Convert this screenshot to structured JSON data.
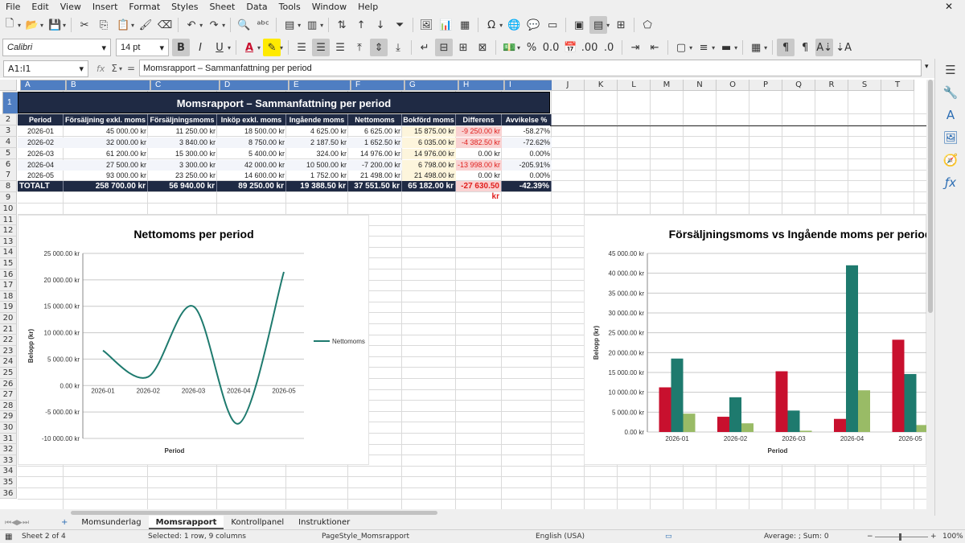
{
  "menu": [
    "File",
    "Edit",
    "View",
    "Insert",
    "Format",
    "Styles",
    "Sheet",
    "Data",
    "Tools",
    "Window",
    "Help"
  ],
  "toolbar": {
    "font_name": "Calibri",
    "font_size": "14 pt"
  },
  "formula": {
    "name_box": "A1:I1",
    "content": "Momsrapport – Sammanfattning per period",
    "fx_icon": "fx",
    "sum_icon": "Σ",
    "eq_icon": "="
  },
  "columns": [
    "A",
    "B",
    "C",
    "D",
    "E",
    "F",
    "G",
    "H",
    "I",
    "J",
    "K",
    "L",
    "M",
    "N",
    "O",
    "P",
    "Q",
    "R",
    "S",
    "T"
  ],
  "rows": [
    "1",
    "2",
    "3",
    "4",
    "5",
    "6",
    "7",
    "8",
    "9",
    "10",
    "11",
    "12",
    "13",
    "14",
    "15",
    "16",
    "17",
    "18",
    "19",
    "20",
    "21",
    "22",
    "23",
    "24",
    "25",
    "26",
    "27",
    "28",
    "29",
    "30",
    "31",
    "32",
    "33",
    "34",
    "35",
    "36"
  ],
  "sheet": {
    "title": "Momsrapport – Sammanfattning per period",
    "headers": [
      "Period",
      "Försäljning exkl. moms",
      "Försäljningsmoms",
      "Inköp exkl. moms",
      "Ingående moms",
      "Nettomoms",
      "Bokförd moms",
      "Differens",
      "Avvikelse %"
    ],
    "rows": [
      [
        "2026-01",
        "45 000.00 kr",
        "11 250.00 kr",
        "18 500.00 kr",
        "4 625.00 kr",
        "6 625.00 kr",
        "15 875.00 kr",
        "-9 250.00 kr",
        "-58.27%"
      ],
      [
        "2026-02",
        "32 000.00 kr",
        "3 840.00 kr",
        "8 750.00 kr",
        "2 187.50 kr",
        "1 652.50 kr",
        "6 035.00 kr",
        "-4 382.50 kr",
        "-72.62%"
      ],
      [
        "2026-03",
        "61 200.00 kr",
        "15 300.00 kr",
        "5 400.00 kr",
        "324.00 kr",
        "14 976.00 kr",
        "14 976.00 kr",
        "0.00 kr",
        "0.00%"
      ],
      [
        "2026-04",
        "27 500.00 kr",
        "3 300.00 kr",
        "42 000.00 kr",
        "10 500.00 kr",
        "-7 200.00 kr",
        "6 798.00 kr",
        "-13 998.00 kr",
        "-205.91%"
      ],
      [
        "2026-05",
        "93 000.00 kr",
        "23 250.00 kr",
        "14 600.00 kr",
        "1 752.00 kr",
        "21 498.00 kr",
        "21 498.00 kr",
        "0.00 kr",
        "0.00%"
      ]
    ],
    "total": [
      "TOTALT",
      "258 700.00 kr",
      "56 940.00 kr",
      "89 250.00 kr",
      "19 388.50 kr",
      "37 551.50 kr",
      "65 182.00 kr",
      "-27 630.50 kr",
      "-42.39%"
    ]
  },
  "colors": {
    "header_bg": "#1f2a44",
    "diff_neg_bg": "#f9d2d2",
    "diff_neg_text": "#e0201e",
    "booked_bg": "#fdf5dc",
    "teal": "#1e7a6e",
    "red": "#c8102e",
    "green": "#99bb66"
  },
  "chart_data": [
    {
      "type": "line",
      "title": "Nettomoms per period",
      "xlabel": "Period",
      "ylabel": "Belopp (kr)",
      "categories": [
        "2026-01",
        "2026-02",
        "2026-03",
        "2026-04",
        "2026-05"
      ],
      "series": [
        {
          "name": "Nettomoms",
          "values": [
            6625,
            1652.5,
            14976,
            -7200,
            21498
          ],
          "color": "#1e7a6e"
        }
      ],
      "ylim": [
        -10000,
        25000
      ],
      "yticks": [
        "25 000.00 kr",
        "20 000.00 kr",
        "15 000.00 kr",
        "10 000.00 kr",
        "5 000.00 kr",
        "0.00 kr",
        "-5 000.00 kr",
        "-10 000.00 kr"
      ],
      "legend": "right",
      "smooth": true
    },
    {
      "type": "bar",
      "title": "Försäljningsmoms vs Ingående moms per period",
      "xlabel": "Period",
      "ylabel": "Belopp (kr)",
      "categories": [
        "2026-01",
        "2026-02",
        "2026-03",
        "2026-04",
        "2026-05"
      ],
      "series": [
        {
          "values": [
            11250,
            3840,
            15300,
            3300,
            23250
          ],
          "color": "#c8102e"
        },
        {
          "values": [
            18500,
            8750,
            5400,
            42000,
            14600
          ],
          "color": "#1e7a6e"
        },
        {
          "values": [
            4625,
            2187.5,
            324,
            10500,
            1752
          ],
          "color": "#99bb66"
        }
      ],
      "ylim": [
        0,
        45000
      ],
      "yticks": [
        "45 000.00 kr",
        "40 000.00 kr",
        "35 000.00 kr",
        "30 000.00 kr",
        "25 000.00 kr",
        "20 000.00 kr",
        "15 000.00 kr",
        "10 000.00 kr",
        "5 000.00 kr",
        "0.00 kr"
      ]
    }
  ],
  "tabs": [
    "Momsunderlag",
    "Momsrapport",
    "Kontrollpanel",
    "Instruktioner"
  ],
  "active_tab": "Momsrapport",
  "status": {
    "sheet": "Sheet 2 of 4",
    "selection": "Selected: 1 row, 9 columns",
    "page_style": "PageStyle_Momsrapport",
    "language": "English (USA)",
    "summary": "Average: ; Sum: 0",
    "zoom": "100%"
  }
}
